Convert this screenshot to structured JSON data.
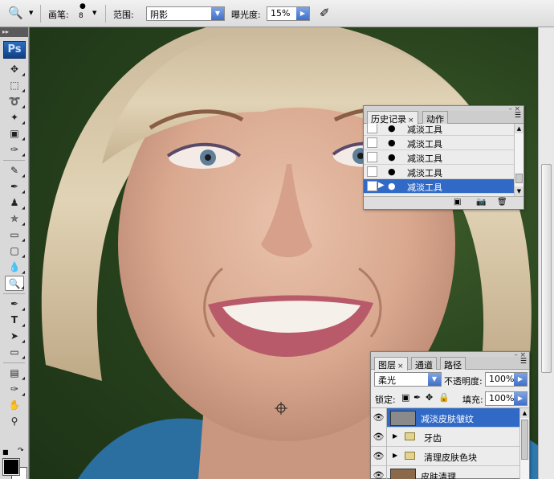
{
  "options_bar": {
    "brush_label": "画笔:",
    "brush_size": "8",
    "range_label": "范围:",
    "range_value": "阴影",
    "exposure_label": "曝光度:",
    "exposure_value": "15%"
  },
  "tools": {
    "logo": "Ps"
  },
  "history_panel": {
    "tab_history": "历史记录",
    "tab_actions": "动作",
    "items": [
      {
        "label": "减淡工具"
      },
      {
        "label": "减淡工具"
      },
      {
        "label": "减淡工具"
      },
      {
        "label": "减淡工具"
      },
      {
        "label": "减淡工具"
      }
    ]
  },
  "layers_panel": {
    "tab_layers": "图层",
    "tab_channels": "通道",
    "tab_paths": "路径",
    "blend_mode": "柔光",
    "opacity_label": "不透明度:",
    "opacity_value": "100%",
    "lock_label": "锁定:",
    "fill_label": "填充:",
    "fill_value": "100%",
    "layers": [
      {
        "name": "减淡皮肤皱纹"
      },
      {
        "name": "牙齿"
      },
      {
        "name": "清理皮肤色块"
      },
      {
        "name": "皮肤清理"
      }
    ]
  },
  "colors": {
    "selection": "#3169c6",
    "panel_bg": "#ececec"
  }
}
